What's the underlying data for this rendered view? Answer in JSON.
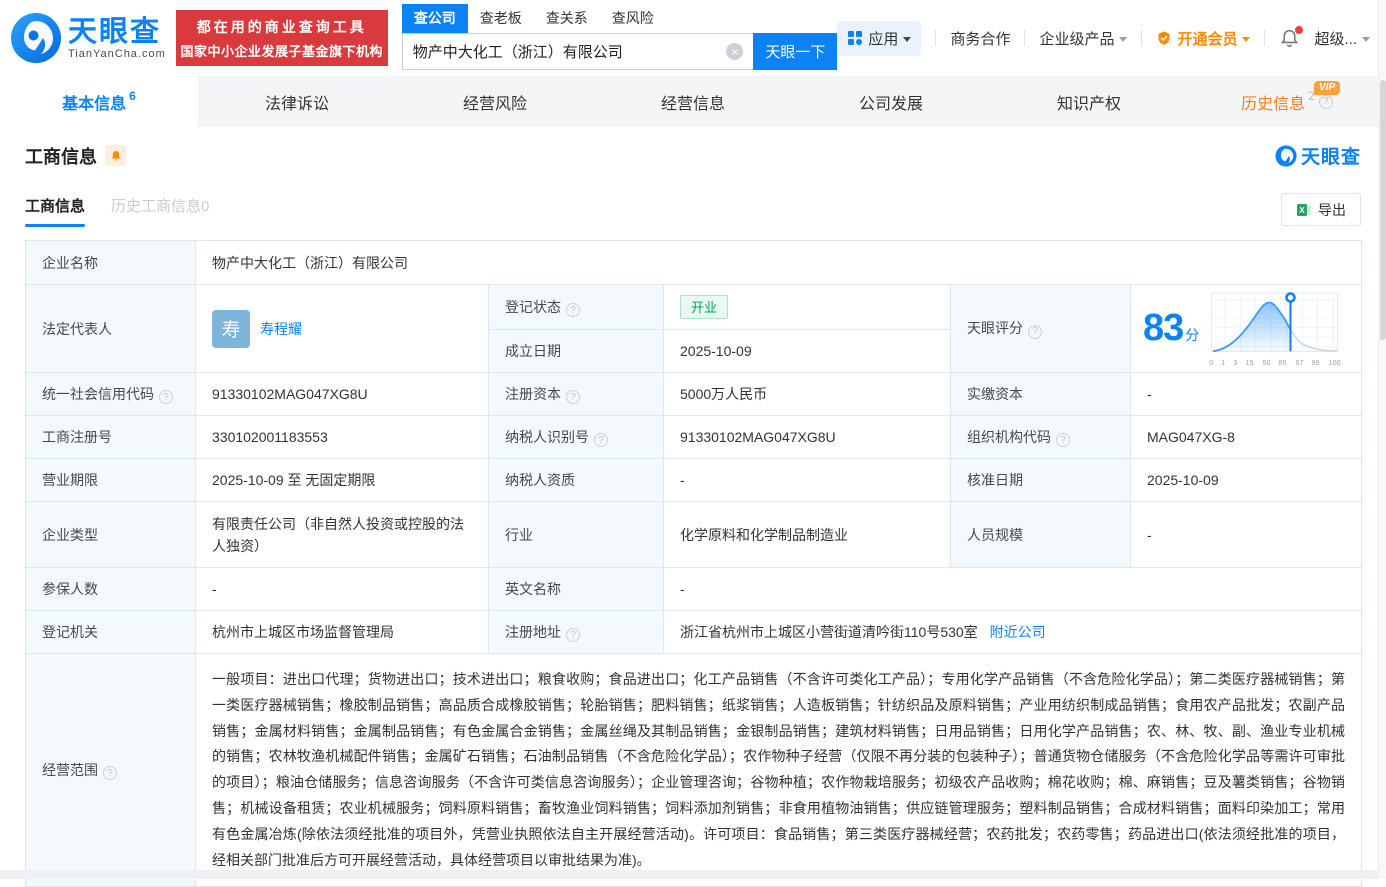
{
  "palette": {
    "brand_blue": "#0b82f5",
    "vip_orange": "#ff8a00",
    "status_green": "#00a860",
    "banner_red": "#d93a3e",
    "label_bg": "#f3f9fd",
    "table_border": "#dbe8f4"
  },
  "icons": {
    "help": "?",
    "clear": "×"
  },
  "header": {
    "brand": "天眼查",
    "brand_domain": "TianYanCha.com",
    "slogan_line1": "都在用的商业查询工具",
    "slogan_line2": "国家中小企业发展子基金旗下机构",
    "search_tabs": [
      "查公司",
      "查老板",
      "查关系",
      "查风险"
    ],
    "search_value": "物产中大化工（浙江）有限公司",
    "search_button": "天眼一下",
    "menu_apps": "应用",
    "menu_cooperation": "商务合作",
    "menu_enterprise": "企业级产品",
    "menu_vip": "开通会员",
    "menu_super": "超级..."
  },
  "nav_tabs": [
    {
      "label": "基本信息",
      "badge": "6"
    },
    {
      "label": "法律诉讼",
      "badge": ""
    },
    {
      "label": "经营风险",
      "badge": ""
    },
    {
      "label": "经营信息",
      "badge": ""
    },
    {
      "label": "公司发展",
      "badge": ""
    },
    {
      "label": "知识产权",
      "badge": ""
    },
    {
      "label": "历史信息",
      "badge": "2",
      "tag": "VIP"
    }
  ],
  "section": {
    "title": "工商信息",
    "watermark": "天眼查",
    "subtab_active": "工商信息",
    "subtab_history": "历史工商信息",
    "subtab_history_count": "0",
    "export": "导出"
  },
  "biz": {
    "company_name": {
      "label": "企业名称",
      "value": "物产中大化工（浙江）有限公司"
    },
    "legal_rep": {
      "label": "法定代表人",
      "avatar_char": "寿",
      "name": "寿程耀"
    },
    "reg_status": {
      "label": "登记状态",
      "value": "开业"
    },
    "establish_date": {
      "label": "成立日期",
      "value": "2025-10-09"
    },
    "score": {
      "label": "天眼评分",
      "value": "83",
      "unit": "分",
      "axis_ticks": [
        "0",
        "1",
        "3",
        "15",
        "50",
        "85",
        "97",
        "99",
        "100"
      ]
    },
    "credit_code": {
      "label": "统一社会信用代码",
      "value": "91330102MAG047XG8U"
    },
    "reg_capital": {
      "label": "注册资本",
      "value": "5000万人民币"
    },
    "paid_capital": {
      "label": "实缴资本",
      "value": "-"
    },
    "reg_number": {
      "label": "工商注册号",
      "value": "330102001183553"
    },
    "taxpayer_id": {
      "label": "纳税人识别号",
      "value": "91330102MAG047XG8U"
    },
    "org_code": {
      "label": "组织机构代码",
      "value": "MAG047XG-8"
    },
    "business_term": {
      "label": "营业期限",
      "value": "2025-10-09 至 无固定期限"
    },
    "taxpayer_quality": {
      "label": "纳税人资质",
      "value": "-"
    },
    "approval_date": {
      "label": "核准日期",
      "value": "2025-10-09"
    },
    "company_type": {
      "label": "企业类型",
      "value": "有限责任公司（非自然人投资或控股的法人独资）"
    },
    "industry": {
      "label": "行业",
      "value": "化学原料和化学制品制造业"
    },
    "staff_size": {
      "label": "人员规模",
      "value": "-"
    },
    "insured_count": {
      "label": "参保人数",
      "value": "-"
    },
    "english_name": {
      "label": "英文名称",
      "value": "-"
    },
    "reg_authority": {
      "label": "登记机关",
      "value": "杭州市上城区市场监督管理局"
    },
    "reg_address": {
      "label": "注册地址",
      "value": "浙江省杭州市上城区小营街道清吟街110号530室",
      "nearby_link": "附近公司"
    },
    "business_scope": {
      "label": "经营范围",
      "value": "一般项目：进出口代理；货物进出口；技术进出口；粮食收购；食品进出口；化工产品销售（不含许可类化工产品）；专用化学产品销售（不含危险化学品）；第二类医疗器械销售；第一类医疗器械销售；橡胶制品销售；高品质合成橡胶销售；轮胎销售；肥料销售；纸浆销售；人造板销售；针纺织品及原料销售；产业用纺织制成品销售；食用农产品批发；农副产品销售；金属材料销售；金属制品销售；有色金属合金销售；金属丝绳及其制品销售；金银制品销售；建筑材料销售；日用品销售；日用化学产品销售；农、林、牧、副、渔业专业机械的销售；农林牧渔机械配件销售；金属矿石销售；石油制品销售（不含危险化学品）；农作物种子经营（仅限不再分装的包装种子）；普通货物仓储服务（不含危险化学品等需许可审批的项目）；粮油仓储服务；信息咨询服务（不含许可类信息咨询服务）；企业管理咨询；谷物种植；农作物栽培服务；初级农产品收购；棉花收购；棉、麻销售；豆及薯类销售；谷物销售；机械设备租赁；农业机械服务；饲料原料销售；畜牧渔业饲料销售；饲料添加剂销售；非食用植物油销售；供应链管理服务；塑料制品销售；合成材料销售；面料印染加工；常用有色金属冶炼(除依法须经批准的项目外，凭营业执照依法自主开展经营活动)。许可项目：食品销售；第三类医疗器械经营；农药批发；农药零售；药品进出口(依法须经批准的项目，经相关部门批准后方可开展经营活动，具体经营项目以审批结果为准)。"
    }
  }
}
